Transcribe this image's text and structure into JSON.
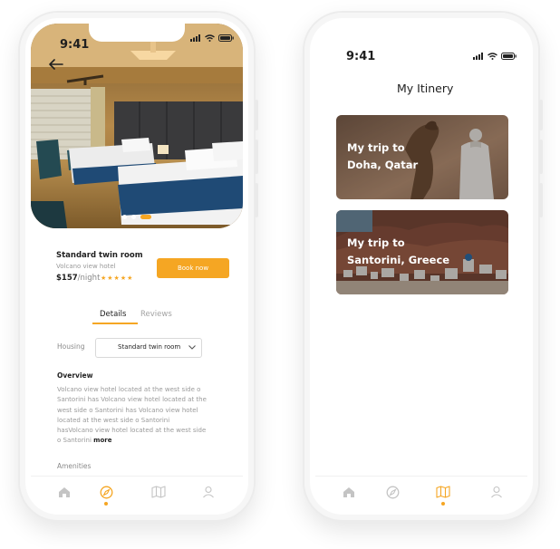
{
  "status": {
    "time": "9:41"
  },
  "hotel": {
    "name": "Standard twin room",
    "hotel_name": "Volcano view hotel",
    "price": "$157",
    "price_unit": "/night",
    "rating_stars": "★★★★★",
    "book_label": "Book now",
    "carousel": {
      "slides": 3,
      "active": 3
    },
    "tabs": {
      "details": "Details",
      "reviews": "Reviews"
    },
    "housing_label": "Housing",
    "housing_value": "Standard twin room",
    "overview_heading": "Overview",
    "overview_lines": [
      "Volcano view hotel located at the west side o",
      "Santorini has Volcano view hotel located at the",
      "west side o Santorini has Volcano view hotel",
      "located at the west side o Santorini",
      "hasVolcano view hotel located at the west side"
    ],
    "overview_last_line": "o Santorini",
    "overview_more": "more",
    "amenities_heading": "Amenities"
  },
  "itinerary": {
    "title": "My Itinery",
    "trips": [
      {
        "line1": "My trip to",
        "line2": "Doha, Qatar"
      },
      {
        "line1": "My trip to",
        "line2": "Santorini, Greece"
      }
    ]
  },
  "nav": {
    "items": [
      "home-icon",
      "compass-icon",
      "map-icon",
      "profile-icon"
    ],
    "left_active": "compass-icon",
    "right_active": "map-icon"
  },
  "colors": {
    "accent": "#f5a623",
    "inactive_icon": "#b8b8b8"
  }
}
